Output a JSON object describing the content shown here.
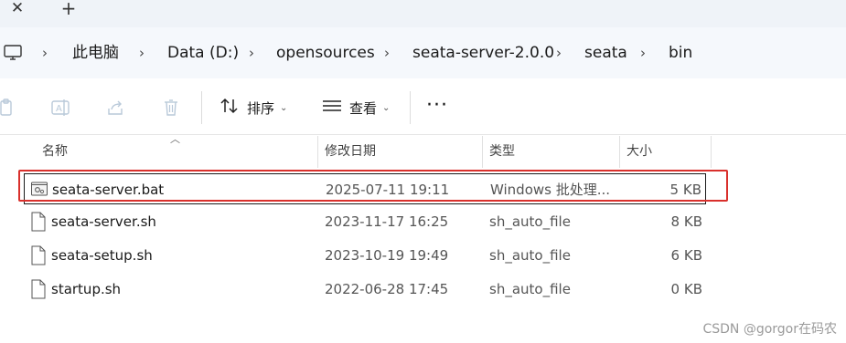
{
  "tabs": {
    "close_glyph": "✕",
    "new_glyph": "+"
  },
  "breadcrumb": {
    "items": [
      "此电脑",
      "Data (D:)",
      "opensources",
      "seata-server-2.0.0",
      "seata",
      "bin"
    ],
    "separator": "›"
  },
  "toolbar": {
    "sort_label": "排序",
    "view_label": "查看",
    "more_label": "···"
  },
  "columns": {
    "name": "名称",
    "modified": "修改日期",
    "type": "类型",
    "size": "大小"
  },
  "files": [
    {
      "name": "seata-server.bat",
      "modified": "2025-07-11 19:11",
      "type": "Windows 批处理...",
      "size": "5 KB",
      "icon": "batch-file-icon"
    },
    {
      "name": "seata-server.sh",
      "modified": "2023-11-17 16:25",
      "type": "sh_auto_file",
      "size": "8 KB",
      "icon": "file-icon"
    },
    {
      "name": "seata-setup.sh",
      "modified": "2023-10-19 19:49",
      "type": "sh_auto_file",
      "size": "6 KB",
      "icon": "file-icon"
    },
    {
      "name": "startup.sh",
      "modified": "2022-06-28 17:45",
      "type": "sh_auto_file",
      "size": "0 KB",
      "icon": "file-icon"
    }
  ],
  "watermark": "CSDN @gorgor在码农",
  "colors": {
    "highlight_border": "#d9302c"
  }
}
